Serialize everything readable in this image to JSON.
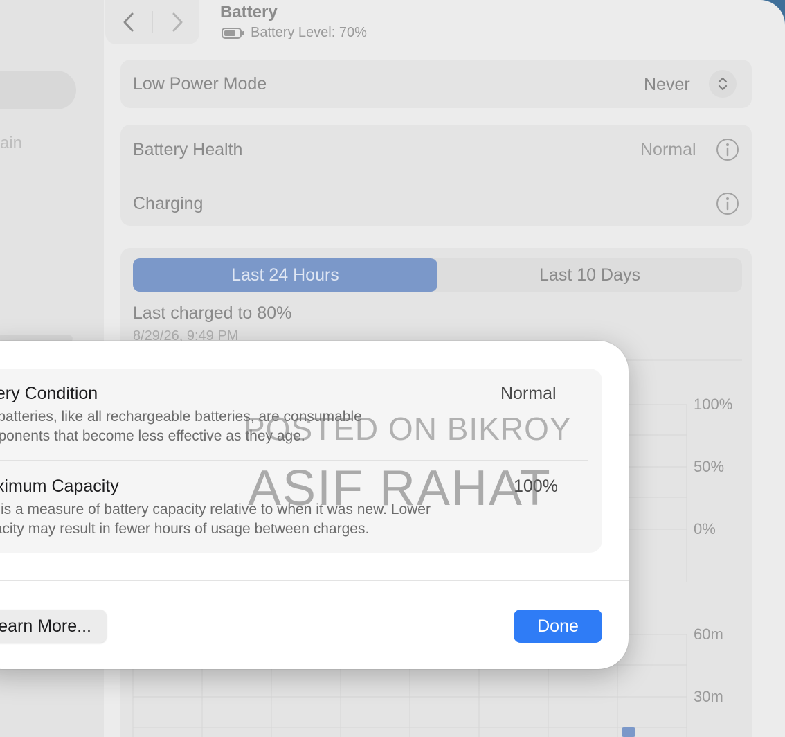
{
  "window": {
    "title": "Battery",
    "subtitle": "Battery Level: 70%"
  },
  "sidebar": {
    "partial_text": "ain"
  },
  "low_power_mode": {
    "label": "Low Power Mode",
    "value": "Never"
  },
  "battery_health": {
    "label": "Battery Health",
    "value": "Normal"
  },
  "charging": {
    "label": "Charging"
  },
  "segmented": {
    "tab1": "Last 24 Hours",
    "tab2": "Last 10 Days",
    "selected": "Last 24 Hours"
  },
  "last_charged": {
    "text": "Last charged to 80%",
    "date": "8/29/26, 9:49 PM"
  },
  "chart_data": [
    {
      "type": "area",
      "title": "",
      "ylim": [
        0,
        100
      ],
      "y_ticks": [
        "100%",
        "50%",
        "0%"
      ],
      "values": []
    },
    {
      "type": "bar",
      "title": "",
      "y_ticks": [
        "60m",
        "30m"
      ],
      "values": []
    }
  ],
  "modal": {
    "condition_title": "ttery Condition",
    "condition_value": "Normal",
    "condition_desc_1": "c batteries, like all rechargeable batteries, are consumable",
    "condition_desc_2": "mponents that become less effective as they age.",
    "capacity_title": "aximum Capacity",
    "capacity_value": "100%",
    "capacity_desc_1": "is is a measure of battery capacity relative to when it was new. Lower",
    "capacity_desc_2": "pacity may result in fewer hours of usage between charges.",
    "learn_more": "earn More...",
    "done": "Done"
  },
  "watermark": {
    "line1": "POSTED ON BIKROY",
    "line2": "ASIF RAHAT"
  },
  "colors": {
    "accent": "#2f7cf6",
    "segment_selected": "#7b98c9",
    "desktop": "#3f6f99"
  }
}
